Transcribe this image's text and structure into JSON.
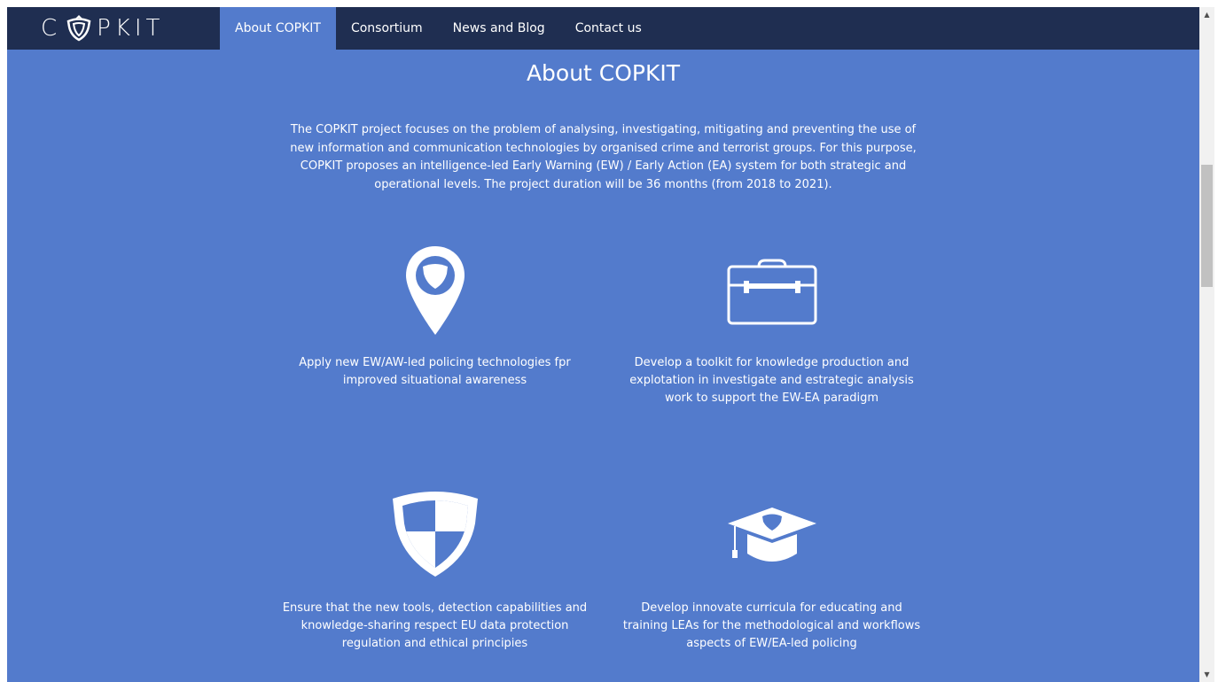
{
  "brand": {
    "logo_text_left": "C",
    "logo_text_right": "PKIT"
  },
  "nav": {
    "items": [
      {
        "label": "About COPKIT"
      },
      {
        "label": "Consortium"
      },
      {
        "label": "News and Blog"
      },
      {
        "label": "Contact us"
      }
    ],
    "active_index": 0
  },
  "main": {
    "title": "About COPKIT",
    "intro": "The COPKIT project focuses on the problem of analysing, investigating, mitigating and preventing the use of new information and communication technologies by organised crime and terrorist groups. For this purpose, COPKIT proposes an intelligence-led Early Warning (EW) / Early Action (EA) system for both strategic and operational levels. The project duration will be 36 months (from 2018 to 2021).",
    "features": [
      {
        "icon": "location-shield-icon",
        "text": "Apply new EW/AW-led policing technologies fpr improved situational awareness"
      },
      {
        "icon": "toolbox-icon",
        "text": "Develop a toolkit for knowledge production and explotation in investigate and estrategic analysis work to support the EW-EA paradigm"
      },
      {
        "icon": "shield-icon",
        "text": "Ensure that the new tools, detection capabilities and knowledge-sharing respect EU data protection regulation and ethical principies"
      },
      {
        "icon": "graduation-cap-icon",
        "text": "Develop innovate curricula for educating and training LEAs for the methodological and workflows aspects of EW/EA-led policing"
      }
    ]
  },
  "colors": {
    "navbar_bg": "#1f2e51",
    "page_bg": "#537bcc",
    "text": "#ffffff"
  }
}
